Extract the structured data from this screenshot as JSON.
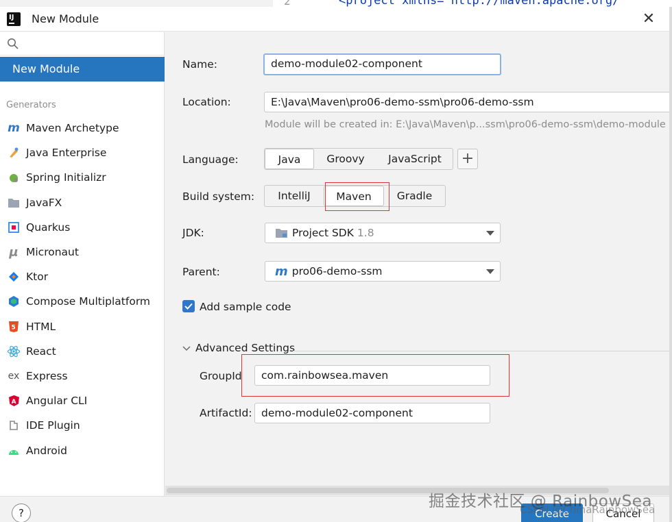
{
  "background": {
    "line_number": "2",
    "code_snippet": "<project xmlns=\"http://maven.apache.org/"
  },
  "window": {
    "title": "New Module",
    "close_symbol": "✕"
  },
  "sidebar": {
    "selected": "New Module",
    "section_label": "Generators",
    "items": [
      {
        "label": "Maven Archetype",
        "icon": "maven-icon"
      },
      {
        "label": "Java Enterprise",
        "icon": "java-enterprise-icon"
      },
      {
        "label": "Spring Initializr",
        "icon": "spring-icon"
      },
      {
        "label": "JavaFX",
        "icon": "javafx-folder-icon"
      },
      {
        "label": "Quarkus",
        "icon": "quarkus-icon"
      },
      {
        "label": "Micronaut",
        "icon": "micronaut-icon"
      },
      {
        "label": "Ktor",
        "icon": "ktor-icon"
      },
      {
        "label": "Compose Multiplatform",
        "icon": "compose-icon"
      },
      {
        "label": "HTML",
        "icon": "html5-icon"
      },
      {
        "label": "React",
        "icon": "react-icon"
      },
      {
        "label": "Express",
        "icon": "express-icon"
      },
      {
        "label": "Angular CLI",
        "icon": "angular-icon"
      },
      {
        "label": "IDE Plugin",
        "icon": "plugin-icon"
      },
      {
        "label": "Android",
        "icon": "android-icon"
      }
    ]
  },
  "form": {
    "name_label": "Name:",
    "name_value": "demo-module02-component",
    "location_label": "Location:",
    "location_value": "E:\\Java\\Maven\\pro06-demo-ssm\\pro06-demo-ssm",
    "location_hint": "Module will be created in: E:\\Java\\Maven\\p...ssm\\pro06-demo-ssm\\demo-module",
    "language_label": "Language:",
    "languages": [
      "Java",
      "Groovy",
      "JavaScript"
    ],
    "language_selected": "Java",
    "add_symbol": "+",
    "build_label": "Build system:",
    "build_systems": [
      "IntelliJ",
      "Maven",
      "Gradle"
    ],
    "build_selected": "Maven",
    "jdk_label": "JDK:",
    "jdk_value": "Project SDK",
    "jdk_version": "1.8",
    "parent_label": "Parent:",
    "parent_value": "pro06-demo-ssm",
    "sample_code_label": "Add sample code",
    "sample_code_checked": true,
    "advanced_label": "Advanced Settings",
    "groupid_label": "GroupId",
    "groupid_value": "com.rainbowsea.maven",
    "artifactid_label": "ArtifactId:",
    "artifactid_value": "demo-module02-component"
  },
  "footer": {
    "help_label": "?",
    "create_label": "Create",
    "cancel_label": "Cancel"
  },
  "watermark": {
    "main": "掘金技术社区 @ RainbowSea",
    "sub": "CSDN @ChinaRainbowSea"
  },
  "colors": {
    "accent": "#2675bf",
    "highlight_box": "#d93636"
  }
}
